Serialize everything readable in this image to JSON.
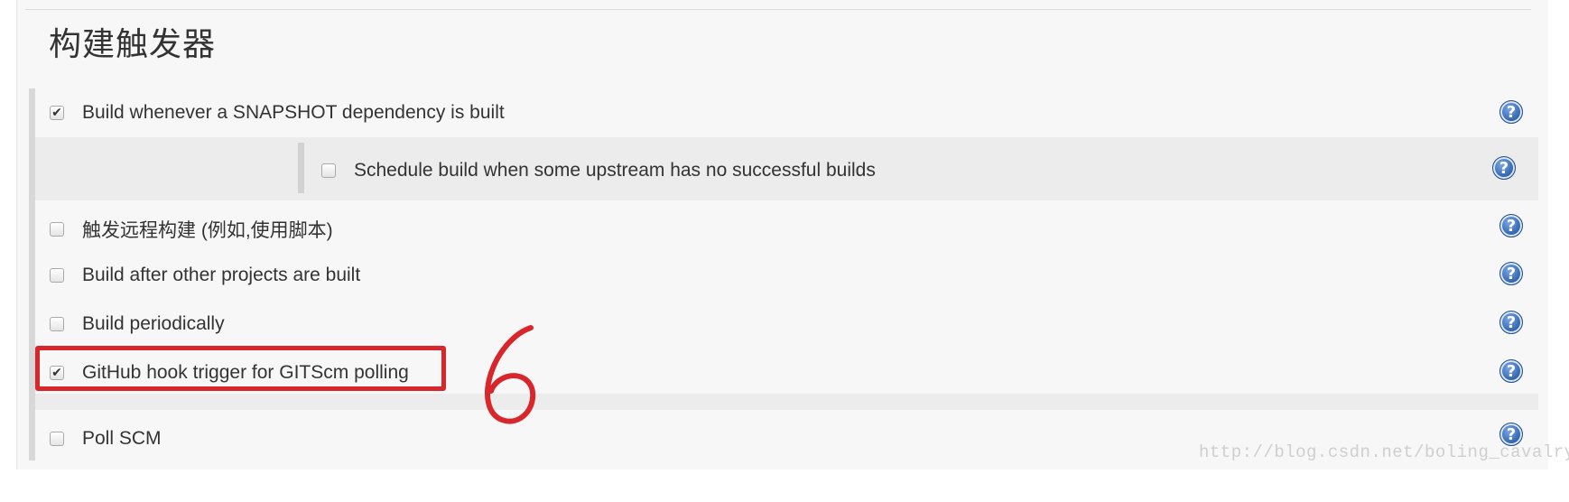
{
  "section": {
    "title": "构建触发器"
  },
  "triggers": [
    {
      "label": "Build whenever a SNAPSHOT dependency is built",
      "checked": true
    },
    {
      "label": "Schedule build when some upstream has no successful builds",
      "checked": false
    },
    {
      "label": "触发远程构建 (例如,使用脚本)",
      "checked": false
    },
    {
      "label": "Build after other projects are built",
      "checked": false
    },
    {
      "label": "Build periodically",
      "checked": false
    },
    {
      "label": "GitHub hook trigger for GITScm polling",
      "checked": true
    },
    {
      "label": "Poll SCM",
      "checked": false
    }
  ],
  "help": {
    "glyph": "?",
    "icon": "help-icon"
  },
  "checkbox": {
    "checked_glyph": "✔",
    "unchecked_glyph": ""
  },
  "annotation": {
    "text": "6",
    "color": "#d9262b"
  },
  "watermark": {
    "text": "http://blog.csdn.net/boling_cavalry"
  },
  "colors": {
    "accent_red": "#d9262b",
    "help_blue": "#2a5ea8",
    "panel_bg": "#f7f7f7"
  }
}
